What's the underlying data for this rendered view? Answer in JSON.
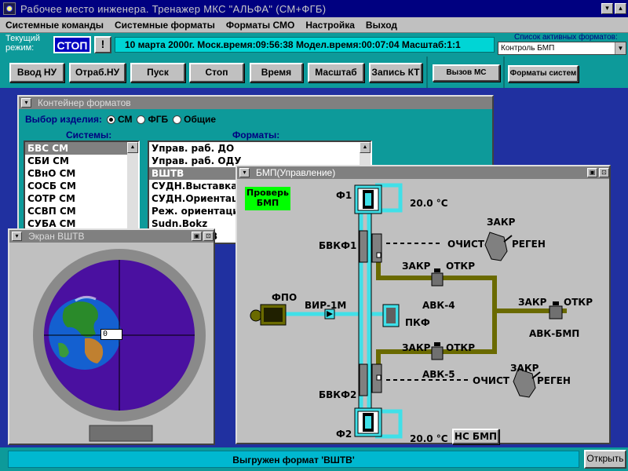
{
  "window": {
    "title": "Рабочее место инженера. Тренажер МКС \"АЛЬФА\" (СМ+ФГБ)",
    "min": "▾",
    "max": "▴"
  },
  "menu": [
    "Системные команды",
    "Системные форматы",
    "Форматы СМО",
    "Настройка",
    "Выход"
  ],
  "status": {
    "mode_label": "Текущий режим:",
    "mode_value": "СТОП",
    "alert_btn": "!",
    "clock": "10 марта 2000г.   Моск.время:09:56:38 Модел.время:00:07:04 Масштаб:1:1",
    "formats_label": "Список активных форматов:",
    "formats_selected": "Контроль БМП",
    "formats_arrow": "▼"
  },
  "toolbar": {
    "buttons": [
      "Ввод НУ",
      "Отраб.НУ",
      "Пуск",
      "Стоп",
      "Время",
      "Масштаб",
      "Запись КТ"
    ],
    "call_ms": "Вызов МС",
    "sys_formats": "Форматы систем"
  },
  "container": {
    "title": "Контейнер форматов",
    "choice_label": "Выбор изделия:",
    "radios": [
      {
        "label": "СМ",
        "on": true
      },
      {
        "label": "ФГБ",
        "on": false
      },
      {
        "label": "Общие",
        "on": false
      }
    ],
    "systems_head": "Системы:",
    "formats_head": "Форматы:",
    "systems": [
      "БВС СМ",
      "СБИ СМ",
      "СВнО СМ",
      "СОСБ СМ",
      "СОТР СМ",
      "ССВП СМ",
      "СУБА СМ"
    ],
    "formats": [
      "Управ. раб. ДО",
      "Управ. раб. ОДУ",
      "ВШТВ",
      "СУДН.Выставка",
      "СУДН.Ориентация",
      "Реж. ориентации",
      "Sudn.Bokz",
      "В"
    ]
  },
  "bmp": {
    "title": "БМП(Управление)",
    "check_btn": [
      "Проверь",
      "БМП"
    ],
    "labels": {
      "f1": "Ф1",
      "temp1": "20.0 °С",
      "bvkf1": "БВКФ1",
      "ochist1": "ОЧИСТ",
      "zakr1": "ЗАКР",
      "regen1": "РЕГЕН",
      "zakr2": "ЗАКР",
      "otkr2": "ОТКР",
      "fpo": "ФПО",
      "vir": "ВИР-1М",
      "avk4": "АВК-4",
      "pkf": "ПКФ",
      "zakr3": "ЗАКР",
      "otkr3": "ОТКР",
      "avkbmp": "АВК-БМП",
      "zakr4": "ЗАКР",
      "otkr4": "ОТКР",
      "avk5": "АВК-5",
      "ochist2": "ОЧИСТ",
      "zakr5": "ЗАКР",
      "regen2": "РЕГЕН",
      "bvkf2": "БВКФ2",
      "f2": "Ф2",
      "temp2": "20.0 °С",
      "ns_bmp": "НС БМП"
    }
  },
  "screen": {
    "title": "Экран ВШТВ",
    "readout": "0"
  },
  "footer": {
    "message": "Выгружен формат 'ВШТВ'",
    "open_btn": "Открыть"
  },
  "colors": {
    "title_bar": "#000080",
    "desktop": "#2030a0",
    "teal": "#0d9a9a",
    "pipe_cyan": "#40e0e8",
    "pipe_olive": "#6a6a00",
    "status_green": "#00ff00",
    "earth_bg": "#4a10a0"
  }
}
